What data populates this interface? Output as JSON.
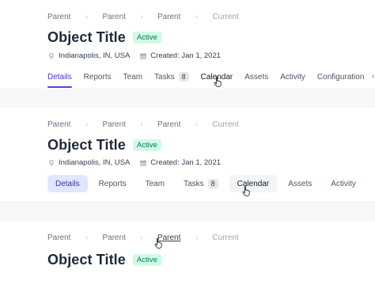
{
  "breadcrumbs": [
    {
      "label": "Parent"
    },
    {
      "label": "Parent"
    },
    {
      "label": "Parent"
    },
    {
      "label": "Current"
    }
  ],
  "object": {
    "title": "Object Title",
    "status": "Active",
    "location": "Indianapolis, IN, USA",
    "created": "Created: Jan 1, 2021"
  },
  "tabs_underline": [
    {
      "label": "Details"
    },
    {
      "label": "Reports"
    },
    {
      "label": "Team"
    },
    {
      "label": "Tasks",
      "count": "8"
    },
    {
      "label": "Calendar"
    },
    {
      "label": "Assets"
    },
    {
      "label": "Activity"
    },
    {
      "label": "Configuration"
    }
  ],
  "tabs_pill": [
    {
      "label": "Details"
    },
    {
      "label": "Reports"
    },
    {
      "label": "Team"
    },
    {
      "label": "Tasks",
      "count": "8"
    },
    {
      "label": "Calendar"
    },
    {
      "label": "Assets"
    },
    {
      "label": "Activity"
    }
  ],
  "colors": {
    "accent": "#4f46e5",
    "badge_bg": "#d1fae5",
    "badge_text": "#047857",
    "pill_active_bg": "#e0e7ff"
  },
  "icons": [
    "location-pin-icon",
    "calendar-icon",
    "hand-cursor-icon",
    "chevron-left-icon"
  ]
}
